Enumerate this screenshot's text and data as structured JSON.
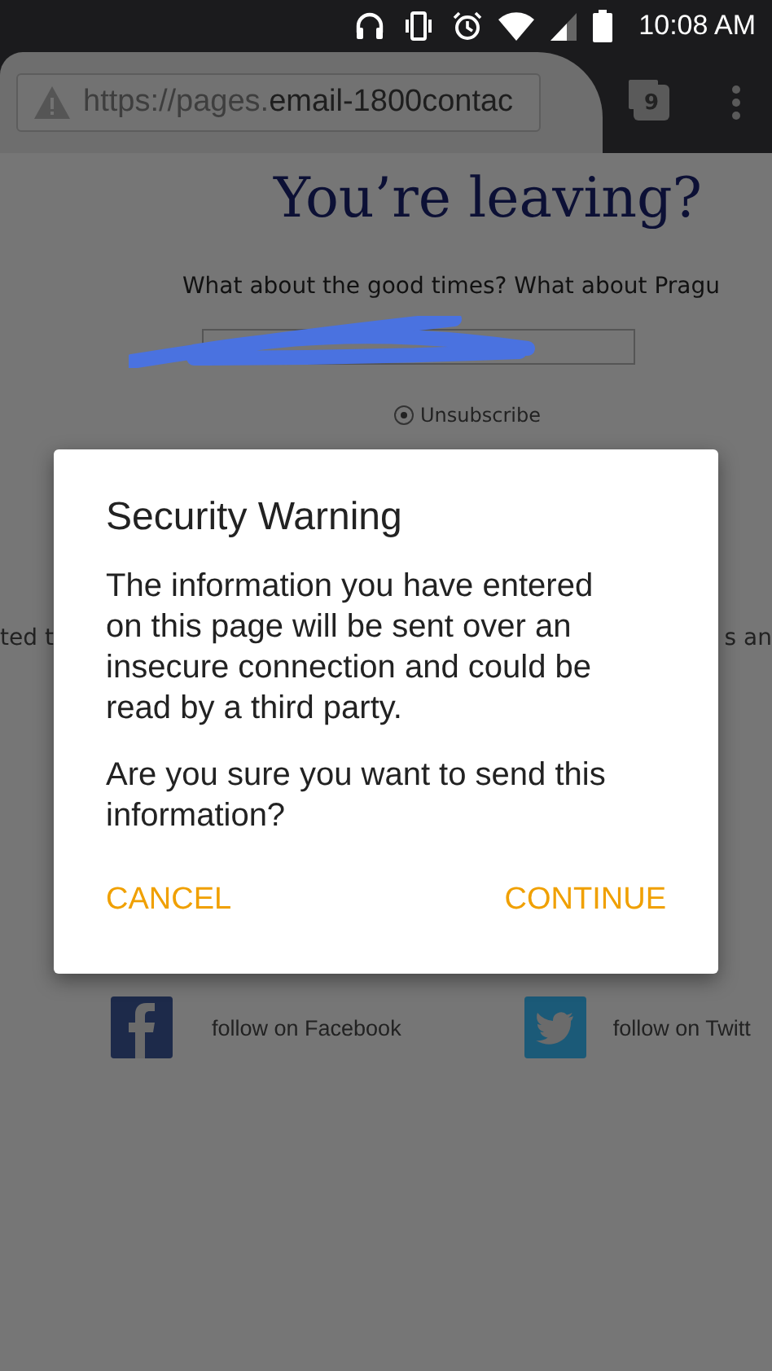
{
  "status_bar": {
    "time": "10:08 AM"
  },
  "browser": {
    "url_host_prefix": "https://pages.",
    "url_domain": "email-1800contac",
    "tab_count": "9"
  },
  "page": {
    "heading": "You’re leaving?",
    "subheading": "What about the good times? What about Pragu",
    "options": [
      {
        "label": "Unsubscribe",
        "selected": true
      }
    ],
    "fragment_left": "ted t",
    "fragment_right": "s an",
    "social": [
      {
        "kind": "facebook",
        "label": "follow on Facebook"
      },
      {
        "kind": "twitter",
        "label": "follow on Twitt"
      }
    ]
  },
  "dialog": {
    "title": "Security Warning",
    "message": "The information you have entered on this page will be sent over an insecure connection and could be read by a third party.",
    "question": "Are you sure you want to send this information?",
    "buttons": [
      "CANCEL",
      "CONTINUE"
    ]
  }
}
